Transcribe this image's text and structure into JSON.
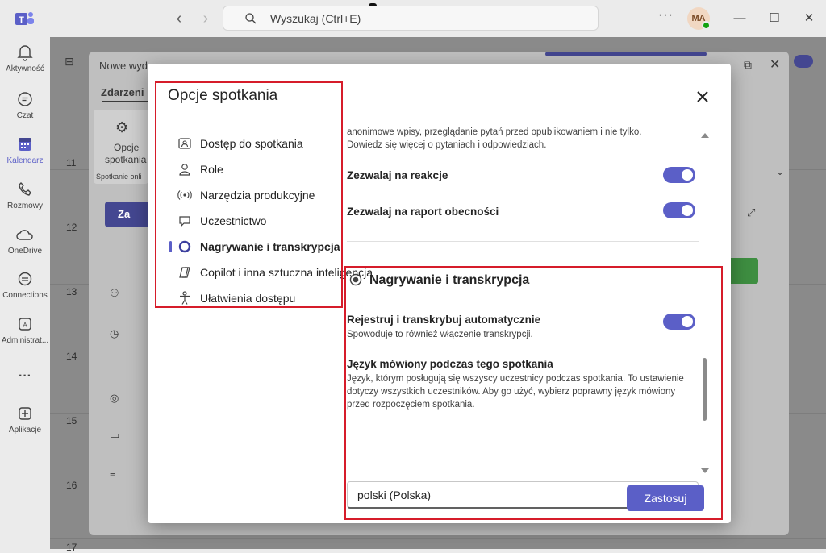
{
  "titlebar": {
    "search_placeholder": "Wyszukaj (Ctrl+E)",
    "more": "···",
    "avatar_initials": "MA",
    "minimize": "—",
    "maximize": "☐",
    "close": "✕"
  },
  "rail": {
    "items": [
      {
        "label": "Aktywność",
        "icon": "bell-icon"
      },
      {
        "label": "Czat",
        "icon": "chat-icon"
      },
      {
        "label": "Kalendarz",
        "icon": "calendar-icon"
      },
      {
        "label": "Rozmowy",
        "icon": "phone-icon"
      },
      {
        "label": "OneDrive",
        "icon": "cloud-icon"
      },
      {
        "label": "Connections",
        "icon": "connections-icon"
      },
      {
        "label": "Administrat...",
        "icon": "admin-icon"
      },
      {
        "label": "···",
        "icon": "more-icon"
      },
      {
        "label": "Aplikacje",
        "icon": "add-app-icon"
      }
    ]
  },
  "background": {
    "window_title": "Nowe wyd",
    "tab": "Zdarzeni",
    "options_label_1": "Opcje",
    "options_label_2": "spotkania",
    "online_label": "Spotkanie onli",
    "save_letters": "Za",
    "hours": [
      "11",
      "12",
      "13",
      "14",
      "15",
      "16",
      "17"
    ]
  },
  "dialog": {
    "title": "Opcje spotkania",
    "menu": [
      {
        "label": "Dostęp do spotkania",
        "icon": "access-card-icon"
      },
      {
        "label": "Role",
        "icon": "person-icon"
      },
      {
        "label": "Narzędzia produkcyjne",
        "icon": "broadcast-icon"
      },
      {
        "label": "Uczestnictwo",
        "icon": "chat-bubble-icon"
      },
      {
        "label": "Nagrywanie i transkrypcja",
        "icon": "record-icon"
      },
      {
        "label": "Copilot i inna sztuczna inteligencja",
        "icon": "copilot-icon"
      },
      {
        "label": "Ułatwienia dostępu",
        "icon": "accessibility-icon"
      }
    ],
    "selected_menu_index": 4,
    "qa_text": "anonimowe wpisy, przeglądanie pytań przed opublikowaniem i nie tylko. Dowiedz się więcej o pytaniach i odpowiedziach.",
    "allow_reactions": "Zezwalaj na reakcje",
    "allow_attendance": "Zezwalaj na raport obecności",
    "recording_section_title": "Nagrywanie i transkrypcja",
    "auto_record_label": "Rejestruj i transkrybuj automatycznie",
    "auto_record_desc": "Spowoduje to również włączenie transkrypcji.",
    "language_label": "Język mówiony podczas tego spotkania",
    "language_desc": "Język, którym posługują się wszyscy uczestnicy podczas spotkania. To ustawienie dotyczy wszystkich uczestników. Aby go użyć, wybierz poprawny język mówiony przed rozpoczęciem spotkania.",
    "language_value": "polski (Polska)",
    "apply_label": "Zastosuj",
    "accent": "#5b5fc7",
    "highlight": "#d61c2a"
  }
}
